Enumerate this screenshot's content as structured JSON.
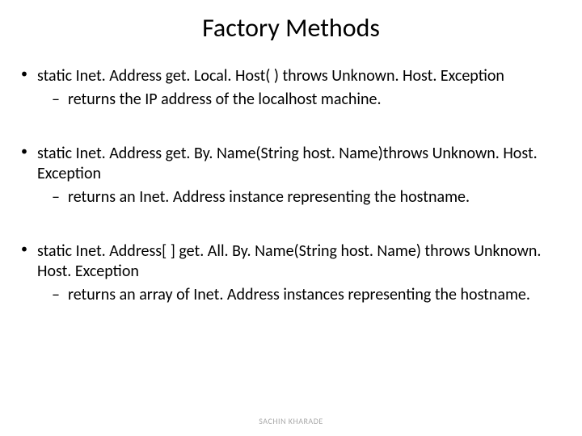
{
  "title": "Factory Methods",
  "items": [
    {
      "signature": "static Inet. Address get. Local. Host( ) throws Unknown. Host. Exception",
      "desc": "returns the IP address of the localhost machine."
    },
    {
      "signature": "static Inet. Address get. By. Name(String host. Name)throws Unknown. Host. Exception",
      "desc": "returns an Inet. Address instance representing the hostname."
    },
    {
      "signature": "static Inet. Address[ ] get. All. By. Name(String host. Name) throws Unknown. Host. Exception",
      "desc": "returns an array of Inet. Address instances representing the hostname."
    }
  ],
  "footer": "SACHIN KHARADE"
}
